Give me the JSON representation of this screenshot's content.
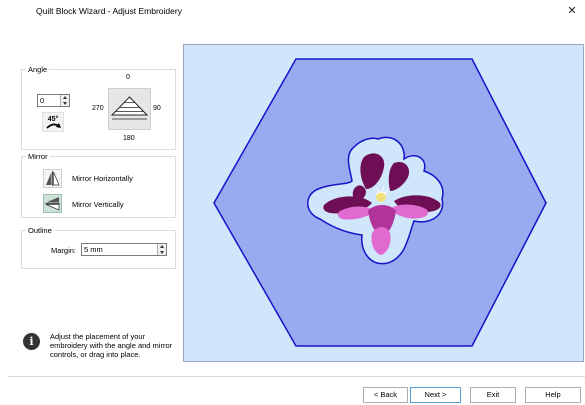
{
  "window": {
    "title": "Quilt Block Wizard - Adjust Embroidery",
    "close_label": "✕"
  },
  "angle": {
    "label": "Angle",
    "value": "0",
    "dial_labels": {
      "top": "0",
      "left": "270",
      "right": "90",
      "bottom": "180"
    },
    "rotate_button_label": "45°"
  },
  "mirror": {
    "label": "Mirror",
    "horizontal_label": "Mirror Horizontally",
    "vertical_label": "Mirror Vertically",
    "vertical_active": true
  },
  "outline": {
    "label": "Outline",
    "margin_label": "Margin:",
    "margin_value": "5 mm"
  },
  "info": {
    "text": "Adjust the placement of your embroidery with the angle and mirror controls, or drag into place."
  },
  "footer": {
    "back_label": "< Back",
    "next_label": "Next >",
    "exit_label": "Exit",
    "help_label": "Help"
  },
  "colors": {
    "canvas_bg": "#cfe6fb",
    "hexagon_fill": "#9aaaf0",
    "hexagon_stroke": "#1414c8",
    "outline_fill": "#cfe6fb",
    "flower_dark": "#6e0f55",
    "flower_magenta": "#b0349a",
    "flower_pink": "#e06ad0",
    "flower_light_pink": "#f2a9e8",
    "flower_yellow": "#f1e07a"
  }
}
